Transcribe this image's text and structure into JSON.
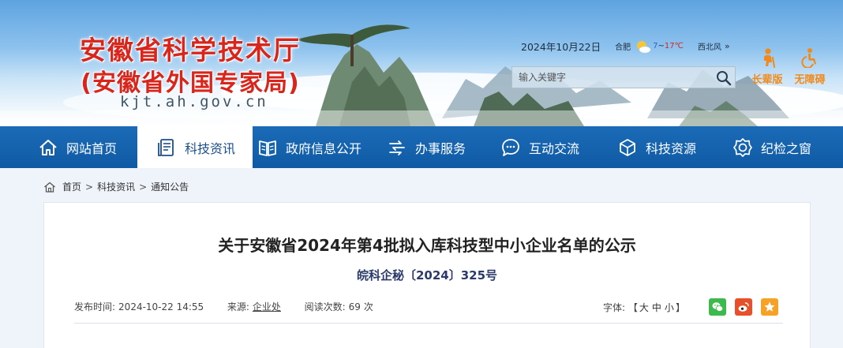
{
  "site": {
    "title_line1": "安徽省科学技术厅",
    "title_line2": "(安徽省外国专家局)",
    "domain": "kjt.ah.gov.cn"
  },
  "topbar": {
    "date": "2024年10月22日",
    "city": "合肥",
    "temp_low": "7",
    "temp_sep": "~",
    "temp_high": "17℃",
    "wind": "西北风",
    "more": "»",
    "weather_icon": "sun-cloud-icon"
  },
  "search": {
    "placeholder": "输入关键字",
    "icon": "search-icon"
  },
  "access": {
    "elder_label": "长辈版",
    "accessible_label": "无障碍",
    "color": "#f08a1c"
  },
  "nav": {
    "items": [
      {
        "label": "网站首页",
        "icon": "home-icon"
      },
      {
        "label": "科技资讯",
        "icon": "news-icon",
        "active": true
      },
      {
        "label": "政府信息公开",
        "icon": "book-icon"
      },
      {
        "label": "办事服务",
        "icon": "service-icon"
      },
      {
        "label": "互动交流",
        "icon": "chat-icon"
      },
      {
        "label": "科技资源",
        "icon": "cube-icon"
      },
      {
        "label": "纪检之窗",
        "icon": "shield-icon"
      }
    ],
    "bg_color": "#155fa9"
  },
  "breadcrumb": {
    "home": "首页",
    "level2": "科技资讯",
    "level3": "通知公告",
    "sep": ">"
  },
  "article": {
    "title": "关于安徽省2024年第4批拟入库科技型中小企业名单的公示",
    "doc_number": "皖科企秘〔2024〕325号",
    "publish_label": "发布时间:",
    "publish_time": "2024-10-22 14:55",
    "source_label": "来源:",
    "source": "企业处",
    "views_label": "阅读次数:",
    "views": "69",
    "views_unit": "次",
    "font_label": "字体:",
    "font_open": "【",
    "font_large": "大",
    "font_medium": "中",
    "font_small": "小",
    "font_close": "】",
    "share": [
      {
        "icon": "wechat-icon",
        "color": "#3eb94e"
      },
      {
        "icon": "weibo-icon",
        "color": "#e8502a"
      },
      {
        "icon": "star-icon",
        "color": "#f5a227"
      }
    ]
  }
}
